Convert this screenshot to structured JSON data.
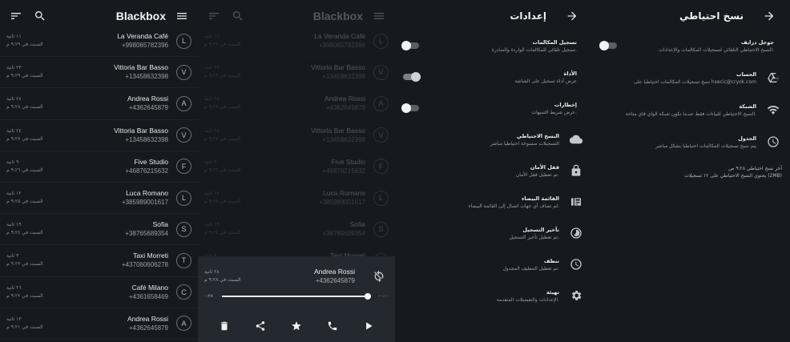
{
  "app": {
    "title": "Blackbox"
  },
  "calls": [
    {
      "initial": "L",
      "name": "La Veranda Café",
      "number": "+998065782396",
      "duration": "١١ ثانية",
      "date": "السبت في ٩:٢٩ م"
    },
    {
      "initial": "V",
      "name": "Vittoria Bar Basso",
      "number": "+13458632398",
      "duration": "٢٣ ثانية",
      "date": "السبت في ٩:٢٩ م"
    },
    {
      "initial": "A",
      "name": "Andrea Rossi",
      "number": "+4362645879",
      "duration": "٢٨ ثانية",
      "date": "السبت في ٩:٢٨ م"
    },
    {
      "initial": "V",
      "name": "Vittoria Bar Basso",
      "number": "+13458632398",
      "duration": "٢٤ ثانية",
      "date": "السبت في ٩:٢٧ م"
    },
    {
      "initial": "F",
      "name": "Five Studio",
      "number": "+46876215632",
      "duration": "٩ ثانية",
      "date": "السبت في ٩:٢٦ م"
    },
    {
      "initial": "L",
      "name": "Luca Romano",
      "number": "+385989001617",
      "duration": "١٢ ثانية",
      "date": "السبت في ٩:٢٥ م"
    },
    {
      "initial": "S",
      "name": "Sofia",
      "number": "+38765689354",
      "duration": "١٩ ثانية",
      "date": "السبت في ٩:٢٤ م"
    },
    {
      "initial": "T",
      "name": "Taxi Morreti",
      "number": "+437060606278",
      "duration": "٣ ثانية",
      "date": "السبت في ٩:٢٣ م"
    },
    {
      "initial": "C",
      "name": "Café Milano",
      "number": "+4361658469",
      "duration": "٢٦ ثانية",
      "date": "السبت في ٩:٢٢ م"
    },
    {
      "initial": "A",
      "name": "Andrea Rossi",
      "number": "+4362645879",
      "duration": "١٣ ثانية",
      "date": "السبت في ٩:٢١ م"
    }
  ],
  "player": {
    "name": "Andrea Rossi",
    "number": "+4362645879",
    "duration": "٢٨ ثانية",
    "date": "السبت في ٩:٢٨ م",
    "elapsed": "٠:٢٨",
    "remaining": "-٠:٠٠",
    "progress": 1.0
  },
  "settings": {
    "title": "إعدادات",
    "items": [
      {
        "heading": "تسجيل المكالمات",
        "desc": "تسجيل تلقائي للمكالمات الواردة والصادرة.",
        "control": "toggle-off"
      },
      {
        "heading": "الأداة",
        "desc": "عرض أداة تسجيل على الشاشة",
        "control": "toggle-on"
      },
      {
        "heading": "إخطارات",
        "desc": "عرض شريط التنبيهات.",
        "control": "toggle-off"
      },
      {
        "heading": "النسخ الاحتياطي",
        "desc": "التسجيلات منسوخة احتياطيا مباشر",
        "icon": "cloud-icon"
      },
      {
        "heading": "قفل الأمان",
        "desc": "تم تعطيل قفل الأمان.",
        "icon": "lock-icon"
      },
      {
        "heading": "القائمة البيضاء",
        "desc": "لم تضاف أي جهات اتصال إلى القائمة البيضاء.",
        "icon": "whitelist-icon"
      },
      {
        "heading": "تأخير التسجيل",
        "desc": "تم تعطيل تأخير التسجيل.",
        "icon": "delay-icon"
      },
      {
        "heading": "تنظف",
        "desc": "تم تعطيل التنظيف المجدول.",
        "icon": "clock-icon"
      },
      {
        "heading": "تهيئة",
        "desc": "الإعدادات والتفضيلات المتقدمة.",
        "icon": "gear-icon"
      }
    ]
  },
  "backup": {
    "title": "نسخ احتياطي",
    "items": [
      {
        "heading": "جوجل درايف",
        "desc": "النسخ الاحتياطي التلقائي لتسجيلات المكالمات والإعدادات.",
        "control": "toggle-off"
      },
      {
        "heading": "الحساب",
        "desc": "نسخ تسجيلات المكالمات احتياطيا على hsecic@cryok.com",
        "icon": "drive-icon"
      },
      {
        "heading": "الشبكة",
        "desc": "النسخ الاحتياطي للبيانات فقط عندما تكون شبكة الواي فاي متاحة.",
        "icon": "wifi-icon"
      },
      {
        "heading": "الجدول",
        "desc": "يتم نسخ تسجيلات المكالمات احتياطيا بشكل مباشر",
        "icon": "clock-icon"
      }
    ],
    "note_line1": "آخر نسخ احتياطي ٩:٢٨ ص",
    "note_line2": "يحتوي النسخ الاحتياطي على ١٢ تسجيلات (2MB)"
  }
}
